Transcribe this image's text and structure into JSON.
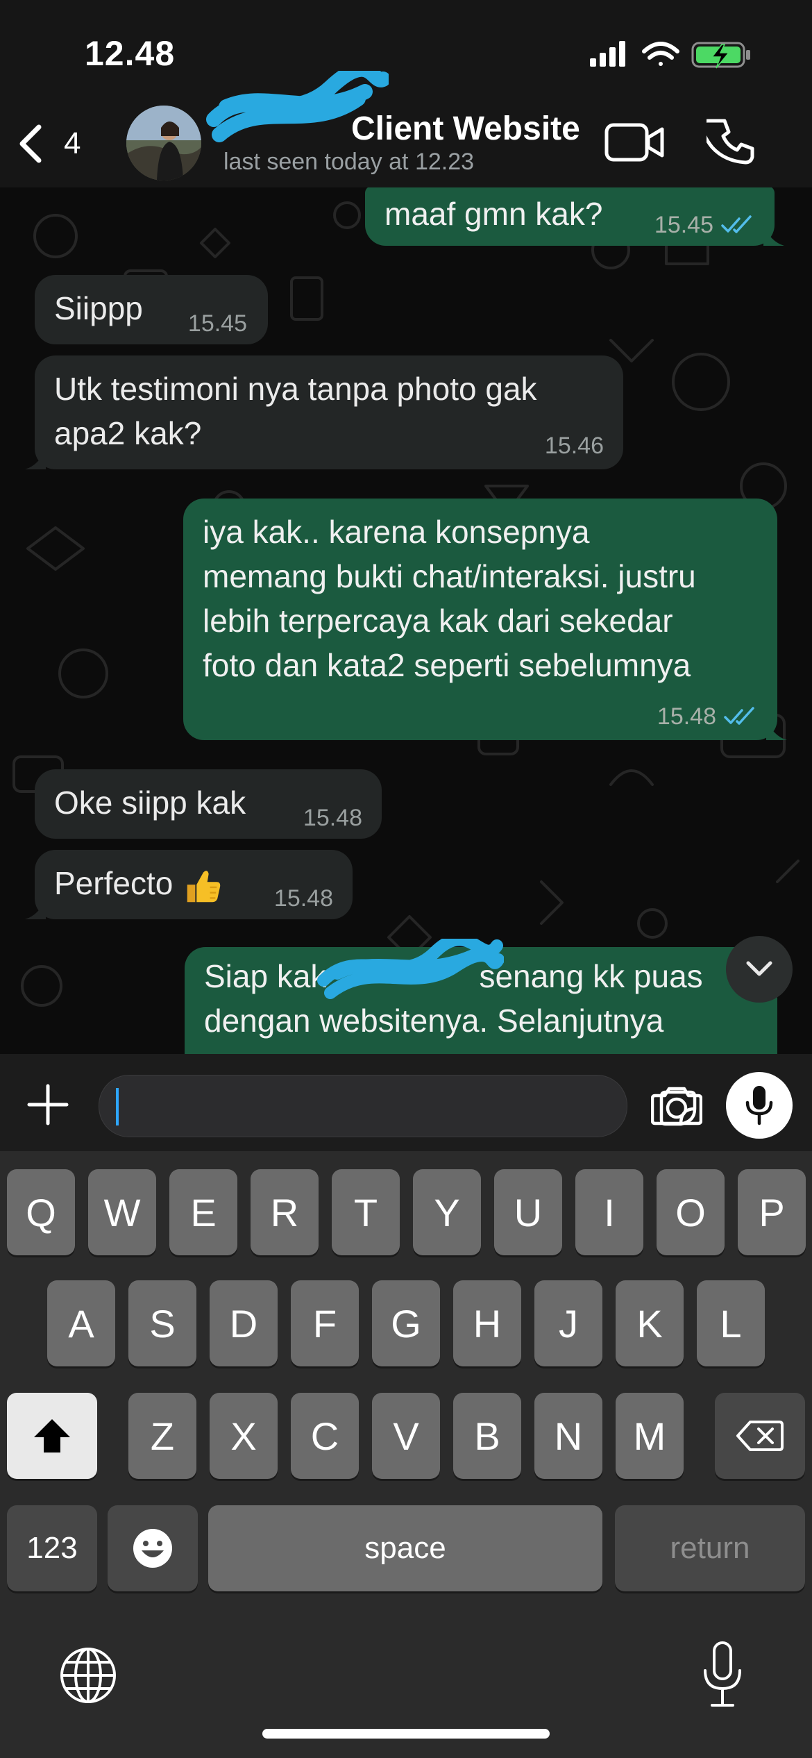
{
  "status_bar": {
    "time": "12.48"
  },
  "header": {
    "back_count": "4",
    "contact_name": "Client Website",
    "last_seen": "last seen today at 12.23"
  },
  "messages": [
    {
      "direction": "out",
      "text": "maaf gmn kak?",
      "time": "15.45",
      "read": true
    },
    {
      "direction": "in",
      "text": "Siippp",
      "time": "15.45"
    },
    {
      "direction": "in",
      "lines": [
        "Utk testimoni nya tanpa photo gak",
        "apa2 kak?"
      ],
      "time": "15.46"
    },
    {
      "direction": "out",
      "lines": [
        "iya kak.. karena konsepnya",
        "memang bukti chat/interaksi. justru",
        "lebih terpercaya kak dari sekedar",
        "foto dan kata2 seperti sebelumnya"
      ],
      "time": "15.48",
      "read": true
    },
    {
      "direction": "in",
      "text": "Oke siipp kak",
      "time": "15.48"
    },
    {
      "direction": "in",
      "text": "Perfecto",
      "emoji": "thumbs-up",
      "time": "15.48"
    },
    {
      "direction": "out",
      "lines": [
        "Siap kak",
        "senang kk puas",
        "dengan websitenya. Selanjutnya"
      ]
    }
  ],
  "input": {
    "placeholder": ""
  },
  "keyboard": {
    "row1": [
      "Q",
      "W",
      "E",
      "R",
      "T",
      "Y",
      "U",
      "I",
      "O",
      "P"
    ],
    "row2": [
      "A",
      "S",
      "D",
      "F",
      "G",
      "H",
      "J",
      "K",
      "L"
    ],
    "row3": [
      "Z",
      "X",
      "C",
      "V",
      "B",
      "N",
      "M"
    ],
    "numbers_label": "123",
    "space_label": "space",
    "return_label": "return"
  },
  "colors": {
    "outgoing_bubble": "#1b5a3f",
    "incoming_bubble": "#232626",
    "read_ticks": "#53bdeb",
    "redaction_scribble": "#29a9e0"
  },
  "icons": [
    "back-chevron-icon",
    "video-call-icon",
    "phone-icon",
    "chevron-down-icon",
    "plus-icon",
    "sticker-icon",
    "camera-icon",
    "microphone-icon",
    "shift-icon",
    "delete-icon",
    "emoji-icon",
    "globe-icon",
    "dictation-icon"
  ]
}
